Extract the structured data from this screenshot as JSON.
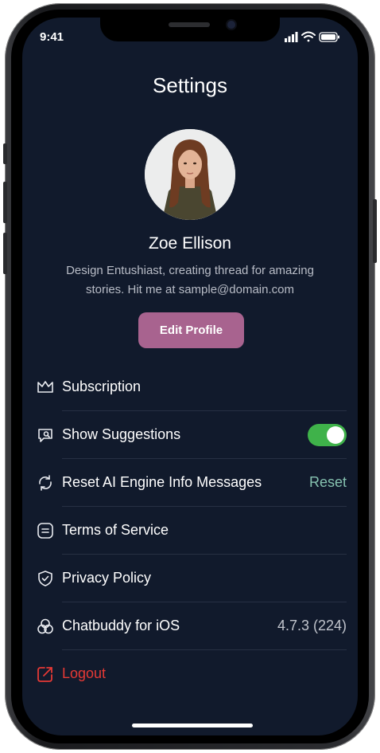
{
  "status": {
    "time": "9:41"
  },
  "header": {
    "title": "Settings"
  },
  "profile": {
    "name": "Zoe Ellison",
    "bio": "Design Entushiast, creating thread for amazing stories. Hit me at sample@domain.com",
    "edit_label": "Edit Profile"
  },
  "settings": {
    "items": [
      {
        "label": "Subscription",
        "icon": "crown-icon"
      },
      {
        "label": "Show Suggestions",
        "icon": "chat-search-icon",
        "toggle_on": true
      },
      {
        "label": "Reset AI Engine Info Messages",
        "icon": "refresh-icon",
        "action": "Reset"
      },
      {
        "label": "Terms of Service",
        "icon": "document-icon"
      },
      {
        "label": "Privacy Policy",
        "icon": "shield-icon"
      },
      {
        "label": "Chatbuddy for iOS",
        "icon": "app-logo-icon",
        "version": "4.7.3 (224)"
      },
      {
        "label": "Logout",
        "icon": "logout-icon"
      }
    ]
  },
  "colors": {
    "background": "#111a2c",
    "accent": "#a8638f",
    "toggle_on": "#3fb24a",
    "reset": "#86c2b0",
    "danger": "#e53935"
  }
}
